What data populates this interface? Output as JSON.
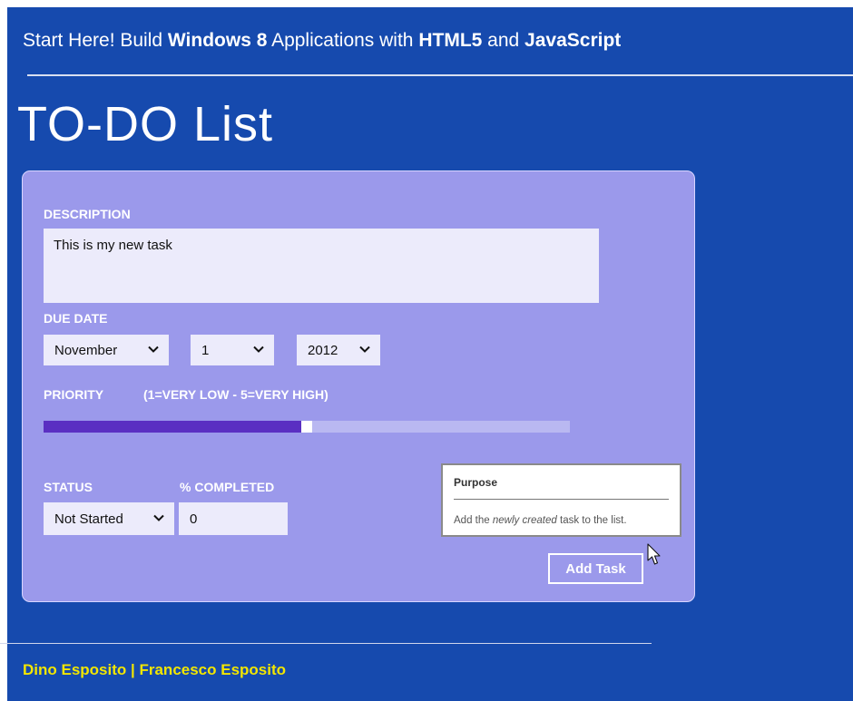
{
  "header": {
    "title_parts": [
      "Start Here! Build ",
      "Windows 8",
      " Applications with ",
      "HTML5",
      " and ",
      "JavaScript"
    ]
  },
  "page_title": "TO-DO List",
  "form": {
    "description_label": "DESCRIPTION",
    "description_value": "This is my new task",
    "due_date_label": "DUE DATE",
    "month_value": "November",
    "day_value": "1",
    "year_value": "2012",
    "priority_label": "PRIORITY",
    "priority_hint": "(1=VERY LOW - 5=VERY HIGH)",
    "priority_value": 3,
    "priority_range": [
      1,
      5
    ],
    "status_label": "STATUS",
    "status_value": "Not Started",
    "percent_label": "% COMPLETED",
    "percent_value": "0",
    "add_button": "Add Task"
  },
  "tooltip": {
    "title": "Purpose",
    "text_before": "Add the ",
    "text_emphasis": "newly created",
    "text_after": " task to the list."
  },
  "footer": {
    "authors": "Dino Esposito | Francesco Esposito"
  },
  "colors": {
    "background": "#164aae",
    "panel": "#9b99eb",
    "priority_fill": "#5a2fc2",
    "footer_text": "#f2e600"
  }
}
